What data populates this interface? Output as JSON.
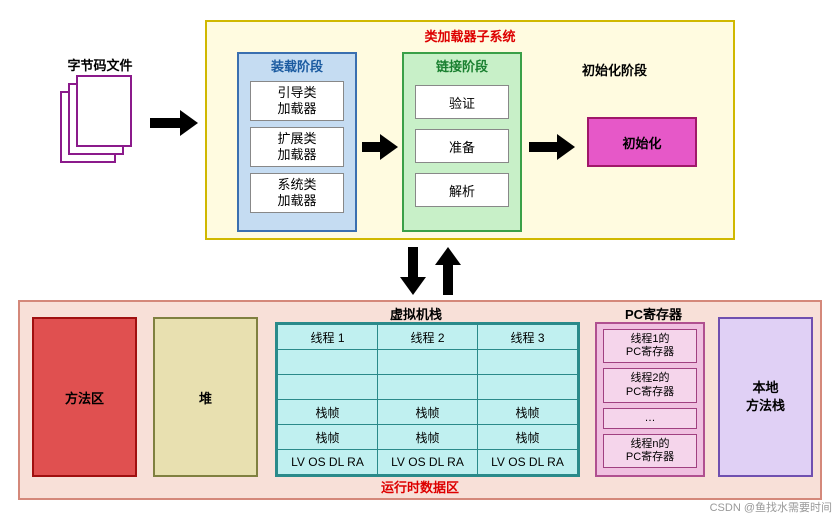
{
  "bytecode_label": "字节码文件",
  "classloader": {
    "title": "类加载器子系统",
    "loading": {
      "title": "装载阶段",
      "items": [
        "引导类\n加载器",
        "扩展类\n加载器",
        "系统类\n加载器"
      ]
    },
    "linking": {
      "title": "链接阶段",
      "items": [
        "验证",
        "准备",
        "解析"
      ]
    },
    "init": {
      "label": "初始化阶段",
      "box": "初始化"
    }
  },
  "runtime": {
    "title": "运行时数据区",
    "method_area": "方法区",
    "heap": "堆",
    "vmstack": {
      "label": "虚拟机栈",
      "threads": [
        "线程 1",
        "线程 2",
        "线程 3"
      ],
      "frame": "栈帧",
      "lvs": "LV OS DL RA"
    },
    "pc": {
      "label": "PC寄存器",
      "items": [
        "线程1的\nPC寄存器",
        "线程2的\nPC寄存器",
        "…",
        "线程n的\nPC寄存器"
      ]
    },
    "native": "本地\n方法栈"
  },
  "watermark": "CSDN @鱼找水需要时间"
}
